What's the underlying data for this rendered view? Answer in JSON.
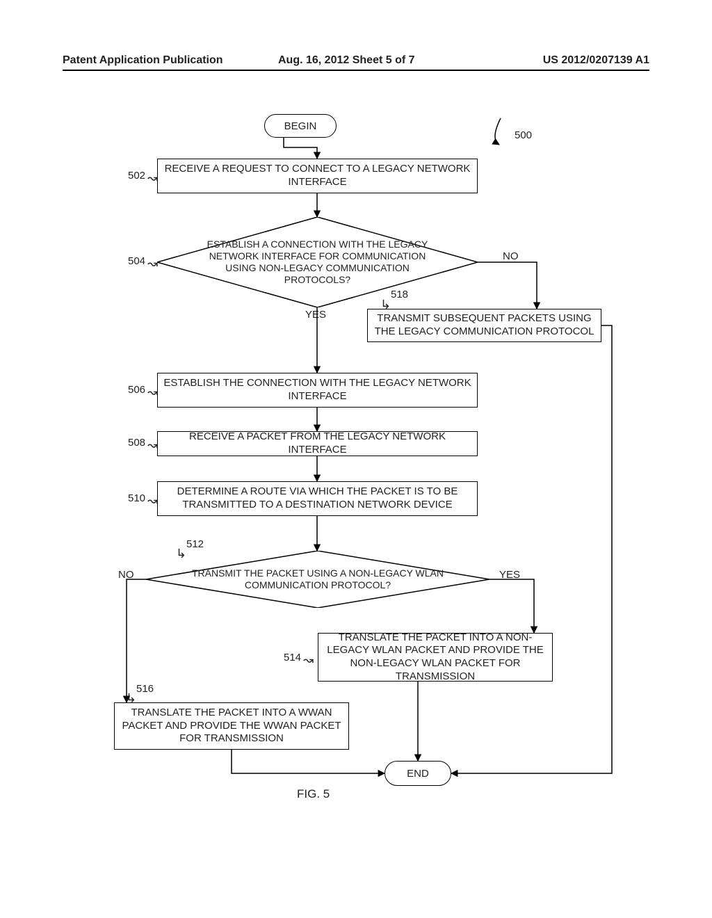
{
  "header": {
    "left": "Patent Application Publication",
    "middle": "Aug. 16, 2012   Sheet 5 of 7",
    "right": "US 2012/0207139 A1"
  },
  "figure_label": "FIG. 5",
  "ref_numerals": {
    "r500": "500",
    "r502": "502",
    "r504": "504",
    "r506": "506",
    "r508": "508",
    "r510": "510",
    "r512": "512",
    "r514": "514",
    "r516": "516",
    "r518": "518"
  },
  "nodes": {
    "begin": "BEGIN",
    "end": "END",
    "step502": "RECEIVE A REQUEST TO CONNECT TO A LEGACY NETWORK INTERFACE",
    "dec504": "ESTABLISH A CONNECTION WITH THE LEGACY NETWORK INTERFACE FOR COMMUNICATION USING NON-LEGACY COMMUNICATION PROTOCOLS?",
    "step518": "TRANSMIT SUBSEQUENT PACKETS USING THE LEGACY COMMUNICATION PROTOCOL",
    "step506": "ESTABLISH THE CONNECTION WITH THE LEGACY NETWORK INTERFACE",
    "step508": "RECEIVE A PACKET FROM THE LEGACY NETWORK INTERFACE",
    "step510": "DETERMINE A ROUTE VIA WHICH THE PACKET IS TO BE TRANSMITTED TO A DESTINATION NETWORK DEVICE",
    "dec512": "TRANSMIT THE PACKET USING A NON-LEGACY WLAN COMMUNICATION PROTOCOL?",
    "step514": "TRANSLATE THE PACKET INTO A NON-LEGACY WLAN PACKET AND PROVIDE THE NON-LEGACY WLAN PACKET FOR TRANSMISSION",
    "step516": "TRANSLATE THE PACKET INTO A WWAN PACKET AND PROVIDE THE WWAN PACKET FOR TRANSMISSION"
  },
  "edge_labels": {
    "yes": "YES",
    "no": "NO"
  }
}
